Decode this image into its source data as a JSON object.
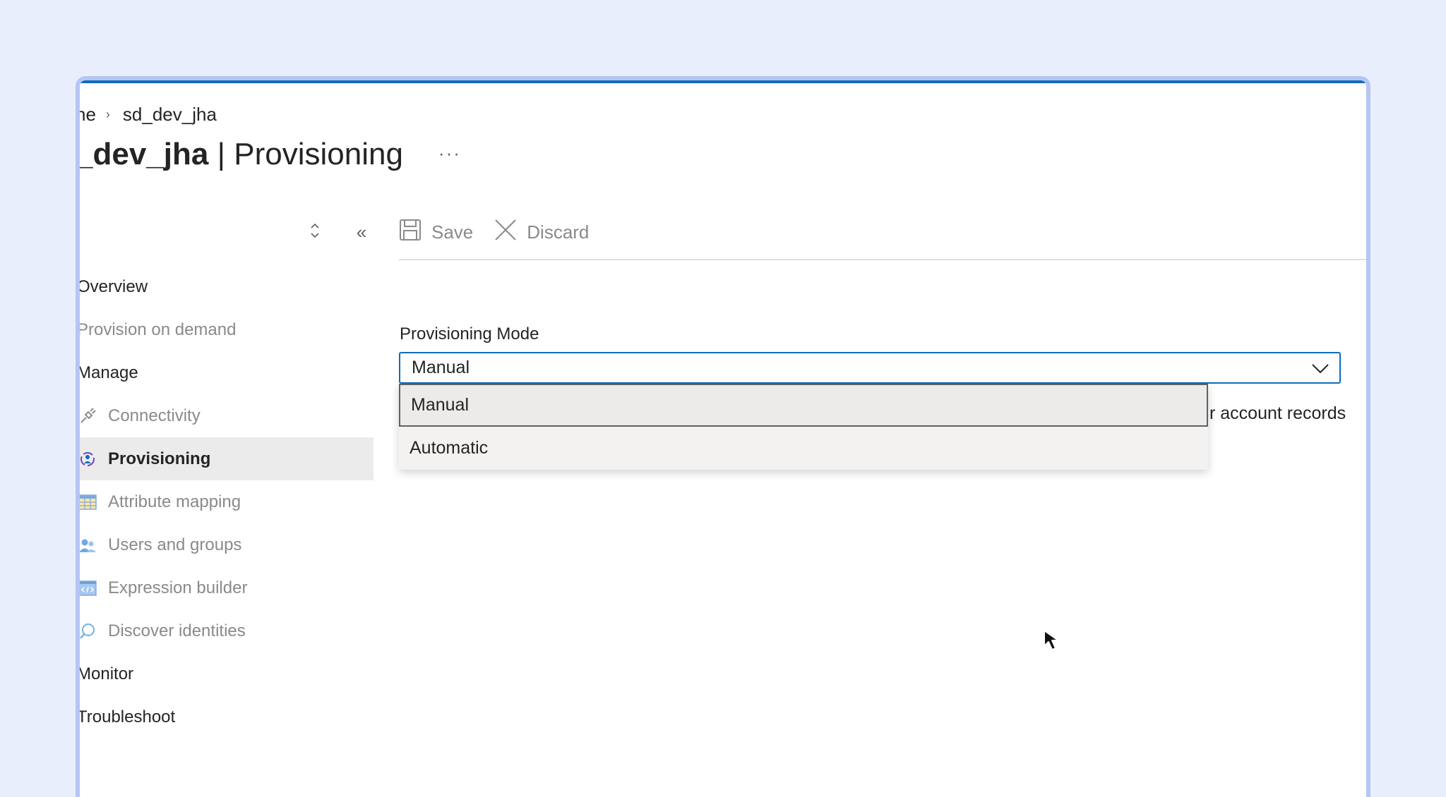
{
  "breadcrumb": {
    "home": "ne",
    "current": "sd_dev_jha"
  },
  "title": {
    "name": "_dev_jha",
    "separator": " | ",
    "section": "Provisioning",
    "more": "···"
  },
  "sidebar": {
    "sort_icon": "⌃⌄",
    "collapse_icon": "«",
    "items": [
      {
        "label": "Overview"
      },
      {
        "label": "Provision on demand"
      },
      {
        "label": "Manage"
      },
      {
        "label": "Connectivity"
      },
      {
        "label": "Provisioning"
      },
      {
        "label": "Attribute mapping"
      },
      {
        "label": "Users and groups"
      },
      {
        "label": "Expression builder"
      },
      {
        "label": "Discover identities"
      },
      {
        "label": "Monitor"
      },
      {
        "label": "Troubleshoot"
      }
    ]
  },
  "toolbar": {
    "save_label": "Save",
    "discard_label": "Discard"
  },
  "form": {
    "provisioning_mode_label": "Provisioning Mode",
    "provisioning_mode_value": "Manual",
    "options": [
      "Manual",
      "Automatic"
    ],
    "background_text": "r account records"
  },
  "colors": {
    "accent": "#0f6cbd",
    "frame": "#b6c5f4",
    "background": "#e8eefc"
  }
}
